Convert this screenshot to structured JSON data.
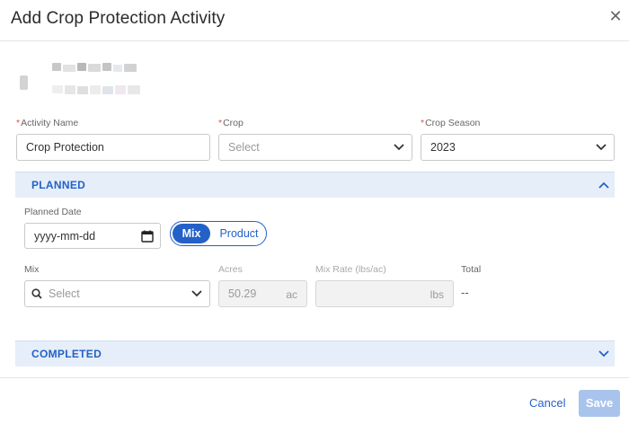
{
  "dialog": {
    "title": "Add Crop Protection Activity",
    "close_glyph": "✕"
  },
  "fields": {
    "activity_name": {
      "label": "Activity Name",
      "required_mark": "*",
      "value": "Crop Protection"
    },
    "crop": {
      "label": "Crop",
      "required_mark": "*",
      "placeholder": "Select"
    },
    "crop_season": {
      "label": "Crop Season",
      "required_mark": "*",
      "value": "2023"
    }
  },
  "planned": {
    "section_label": "PLANNED",
    "planned_date": {
      "label": "Planned Date",
      "placeholder": "yyyy-mm-dd"
    },
    "toggle": {
      "mix_label": "Mix",
      "product_label": "Product",
      "selected": "Mix"
    },
    "mix": {
      "label": "Mix",
      "placeholder": "Select"
    },
    "acres": {
      "label": "Acres",
      "value": "50.29",
      "unit": "ac"
    },
    "mix_rate": {
      "label": "Mix Rate (lbs/ac)",
      "value": "",
      "unit": "lbs"
    },
    "total": {
      "label": "Total",
      "value": "--"
    }
  },
  "completed": {
    "section_label": "COMPLETED"
  },
  "footer": {
    "cancel_label": "Cancel",
    "save_label": "Save"
  },
  "colors": {
    "accent": "#2461c7",
    "section_bg": "#e6eef9",
    "required": "#d9534f",
    "save_disabled": "#a9c4ec"
  }
}
